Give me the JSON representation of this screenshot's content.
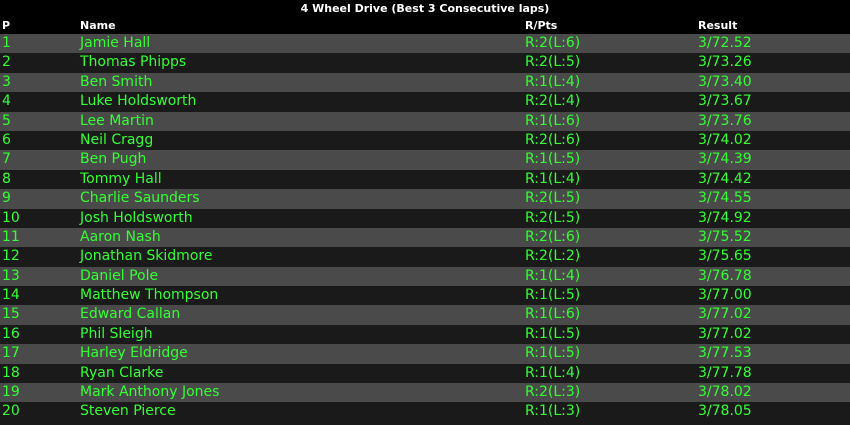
{
  "title": "4 Wheel Drive (Best 3 Consecutive laps)",
  "headers": {
    "pos": "P",
    "name": "Name",
    "rpts": "R/Pts",
    "result": "Result"
  },
  "rows": [
    {
      "pos": "1",
      "name": "Jamie Hall",
      "rpts": "R:2(L:6)",
      "result": "3/72.52"
    },
    {
      "pos": "2",
      "name": "Thomas Phipps",
      "rpts": "R:2(L:5)",
      "result": "3/73.26"
    },
    {
      "pos": "3",
      "name": "Ben Smith",
      "rpts": "R:1(L:4)",
      "result": "3/73.40"
    },
    {
      "pos": "4",
      "name": "Luke Holdsworth",
      "rpts": "R:2(L:4)",
      "result": "3/73.67"
    },
    {
      "pos": "5",
      "name": "Lee Martin",
      "rpts": "R:1(L:6)",
      "result": "3/73.76"
    },
    {
      "pos": "6",
      "name": "Neil Cragg",
      "rpts": "R:2(L:6)",
      "result": "3/74.02"
    },
    {
      "pos": "7",
      "name": "Ben Pugh",
      "rpts": "R:1(L:5)",
      "result": "3/74.39"
    },
    {
      "pos": "8",
      "name": "Tommy Hall",
      "rpts": "R:1(L:4)",
      "result": "3/74.42"
    },
    {
      "pos": "9",
      "name": "Charlie Saunders",
      "rpts": "R:2(L:5)",
      "result": "3/74.55"
    },
    {
      "pos": "10",
      "name": "Josh Holdsworth",
      "rpts": "R:2(L:5)",
      "result": "3/74.92"
    },
    {
      "pos": "11",
      "name": "Aaron Nash",
      "rpts": "R:2(L:6)",
      "result": "3/75.52"
    },
    {
      "pos": "12",
      "name": "Jonathan Skidmore",
      "rpts": "R:2(L:2)",
      "result": "3/75.65"
    },
    {
      "pos": "13",
      "name": "Daniel Pole",
      "rpts": "R:1(L:4)",
      "result": "3/76.78"
    },
    {
      "pos": "14",
      "name": "Matthew Thompson",
      "rpts": "R:1(L:5)",
      "result": "3/77.00"
    },
    {
      "pos": "15",
      "name": "Edward Callan",
      "rpts": "R:1(L:6)",
      "result": "3/77.02"
    },
    {
      "pos": "16",
      "name": "Phil Sleigh",
      "rpts": "R:1(L:5)",
      "result": "3/77.02"
    },
    {
      "pos": "17",
      "name": "Harley Eldridge",
      "rpts": "R:1(L:5)",
      "result": "3/77.53"
    },
    {
      "pos": "18",
      "name": "Ryan Clarke",
      "rpts": "R:1(L:4)",
      "result": "3/77.78"
    },
    {
      "pos": "19",
      "name": "Mark Anthony Jones",
      "rpts": "R:2(L:3)",
      "result": "3/78.02"
    },
    {
      "pos": "20",
      "name": "Steven Pierce",
      "rpts": "R:1(L:3)",
      "result": "3/78.05"
    }
  ],
  "colors": {
    "background": "#000000",
    "row_odd": "#4a4a4a",
    "row_even": "#1a1a1a",
    "row_text": "#33ff33",
    "header_text": "#ffffff"
  }
}
